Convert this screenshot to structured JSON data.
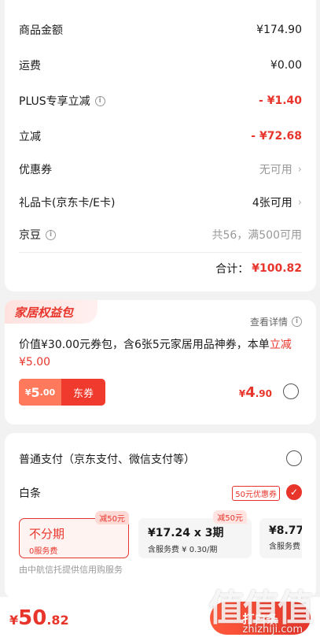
{
  "summary": {
    "goods_label": "商品金额",
    "goods_value": "¥174.90",
    "shipping_label": "运费",
    "shipping_value": "¥0.00",
    "plus_label": "PLUS专享立减",
    "plus_value": "- ¥1.40",
    "discount_label": "立减",
    "discount_value": "- ¥72.68",
    "coupon_label": "优惠券",
    "coupon_value": "无可用",
    "giftcard_label": "礼品卡(京东卡/E卡)",
    "giftcard_value": "4张可用",
    "jingdou_label": "京豆",
    "jingdou_value": "共56，满500可用",
    "total_label": "合计：",
    "total_value": "¥100.82"
  },
  "benefit": {
    "tag": "家居权益包",
    "detail_link": "查看详情",
    "desc_main": "价值¥30.00元券包，含6张5元家居用品神券，本单",
    "desc_hl": "立减¥5.00",
    "coupon_amount_symbol": "¥",
    "coupon_amount_int": "5",
    "coupon_amount_dec": ".00",
    "coupon_name": "东券",
    "price_symbol": "¥",
    "price_int": "4",
    "price_dec": ".90"
  },
  "payment": {
    "normal_label": "普通支付（京东支付、微信支付等）",
    "baitiao_label": "白条",
    "baitiao_badge": "50元优惠券",
    "plans": [
      {
        "title": "不分期",
        "sub": "0服务费",
        "badge": "减50元"
      },
      {
        "title": "¥17.24 x 3期",
        "sub": "含服务费 ¥ 0.30/期",
        "badge": "减50元"
      },
      {
        "title": "¥8.77",
        "sub": "含服务费"
      }
    ],
    "provider": "由中航信托提供信用购服务"
  },
  "bottom": {
    "total_symbol": "¥",
    "total_int": "50",
    "total_dec": ".82",
    "pay_button": "打白条"
  },
  "watermark": {
    "glyphs": "值值值",
    "url": "zhizhiji.com"
  },
  "colors": {
    "accent": "#e8352b",
    "background": "#f2f2f2"
  }
}
